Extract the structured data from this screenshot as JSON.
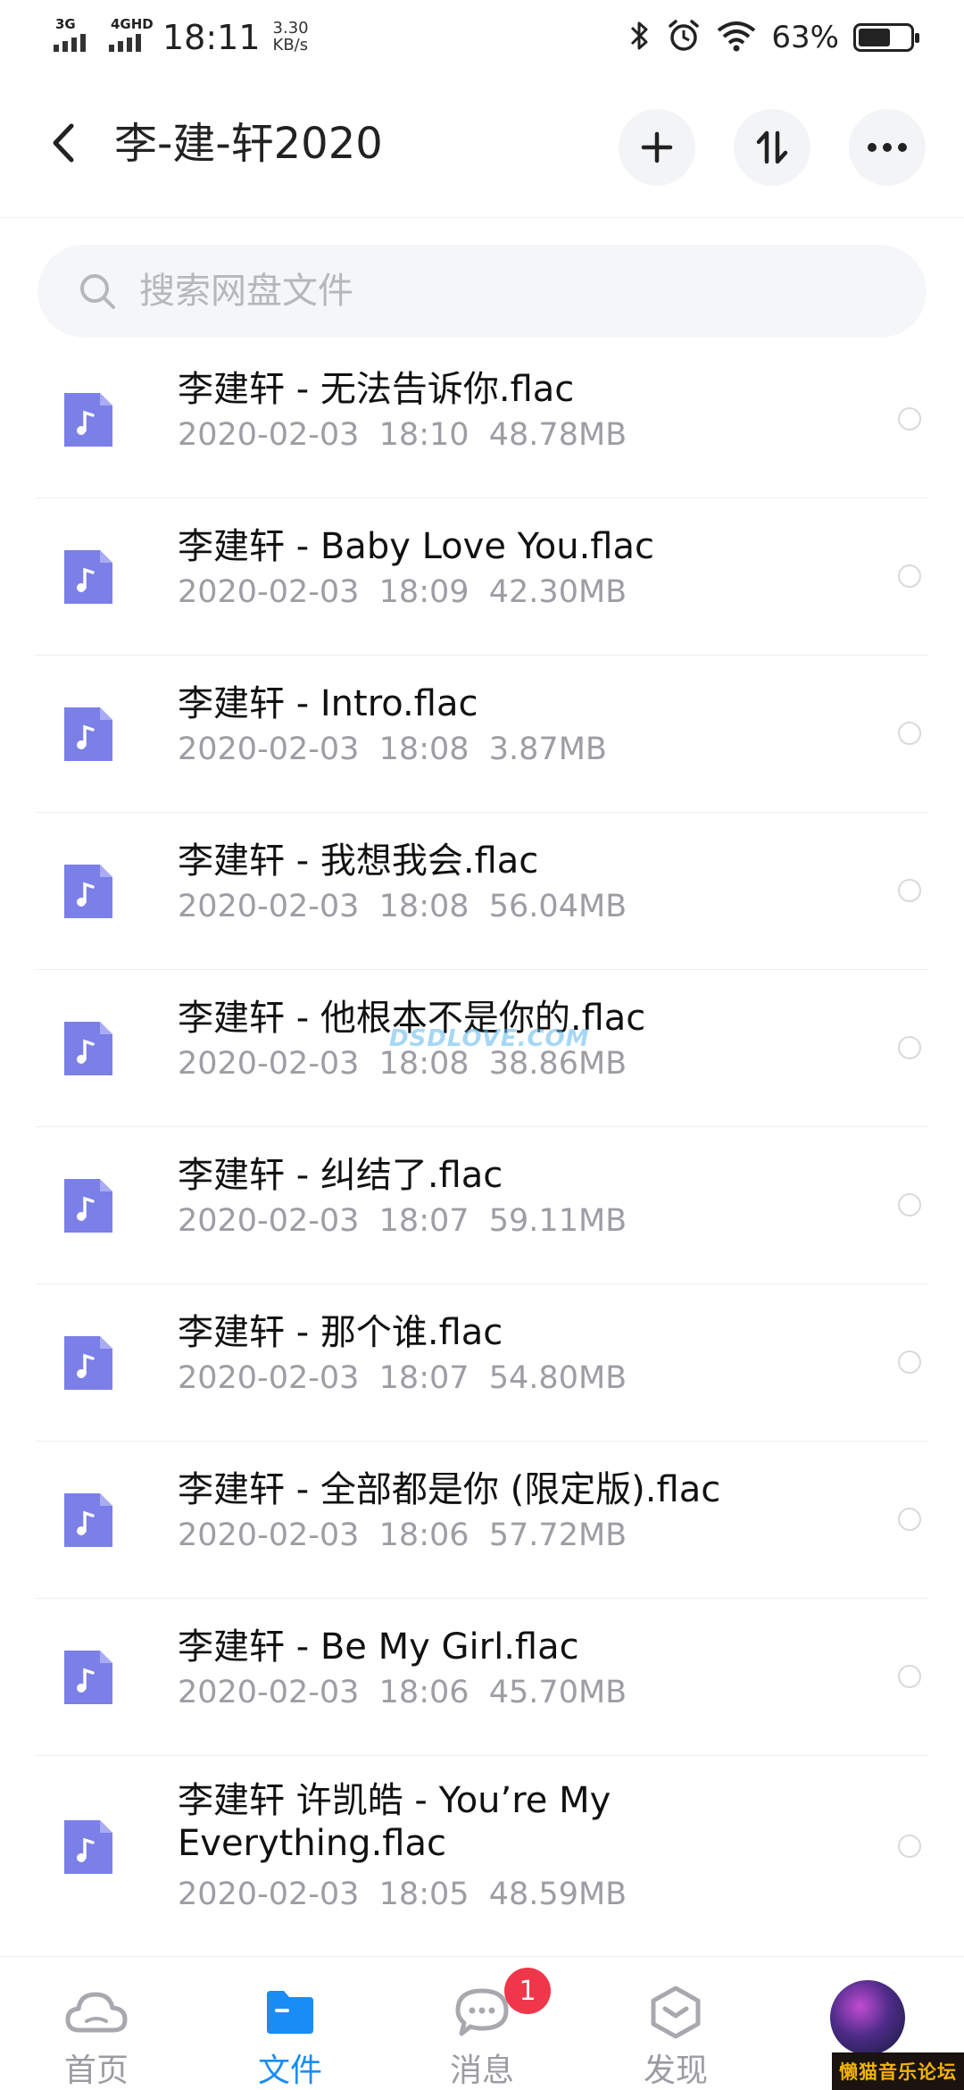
{
  "status_bar": {
    "network1": "3G",
    "network2": "4GHD",
    "time": "18:11",
    "speed_value": "3.30",
    "speed_unit": "KB/s",
    "battery_percent": "63%",
    "battery_level": 0.63,
    "icons": [
      "bluetooth-icon",
      "alarm-icon",
      "wifi-icon",
      "battery-icon"
    ]
  },
  "header": {
    "title": "李-建-轩2020"
  },
  "search": {
    "placeholder": "搜索网盘文件"
  },
  "files": [
    {
      "name": "李建轩 - 无法告诉你.flac",
      "meta": "2020-02-03  18:10  48.78MB"
    },
    {
      "name": "李建轩 - Baby Love You.flac",
      "meta": "2020-02-03  18:09  42.30MB"
    },
    {
      "name": "李建轩 - Intro.flac",
      "meta": "2020-02-03  18:08  3.87MB"
    },
    {
      "name": "李建轩 - 我想我会.flac",
      "meta": "2020-02-03  18:08  56.04MB"
    },
    {
      "name": "李建轩 - 他根本不是你的.flac",
      "meta": "2020-02-03  18:08  38.86MB"
    },
    {
      "name": "李建轩 - 纠结了.flac",
      "meta": "2020-02-03  18:07  59.11MB"
    },
    {
      "name": "李建轩 - 那个谁.flac",
      "meta": "2020-02-03  18:07  54.80MB"
    },
    {
      "name": "李建轩 - 全部都是你 (限定版).flac",
      "meta": "2020-02-03  18:06  57.72MB"
    },
    {
      "name": "李建轩 - Be My Girl.flac",
      "meta": "2020-02-03  18:06  45.70MB"
    },
    {
      "name": "李建轩 许凯皓 - You’re My Everything.flac",
      "meta": "2020-02-03  18:05  48.59MB"
    }
  ],
  "watermark": "DSDLOVE.COM",
  "bottom_nav": {
    "home": "首页",
    "files": "文件",
    "messages": "消息",
    "messages_badge": "1",
    "discover": "发现"
  },
  "brand_logo": "懒猫音乐论坛",
  "colors": {
    "accent": "#1a8cf5",
    "file_icon": "#7b7fe8",
    "badge": "#f0364a",
    "meta_text": "#9c9ea3"
  }
}
